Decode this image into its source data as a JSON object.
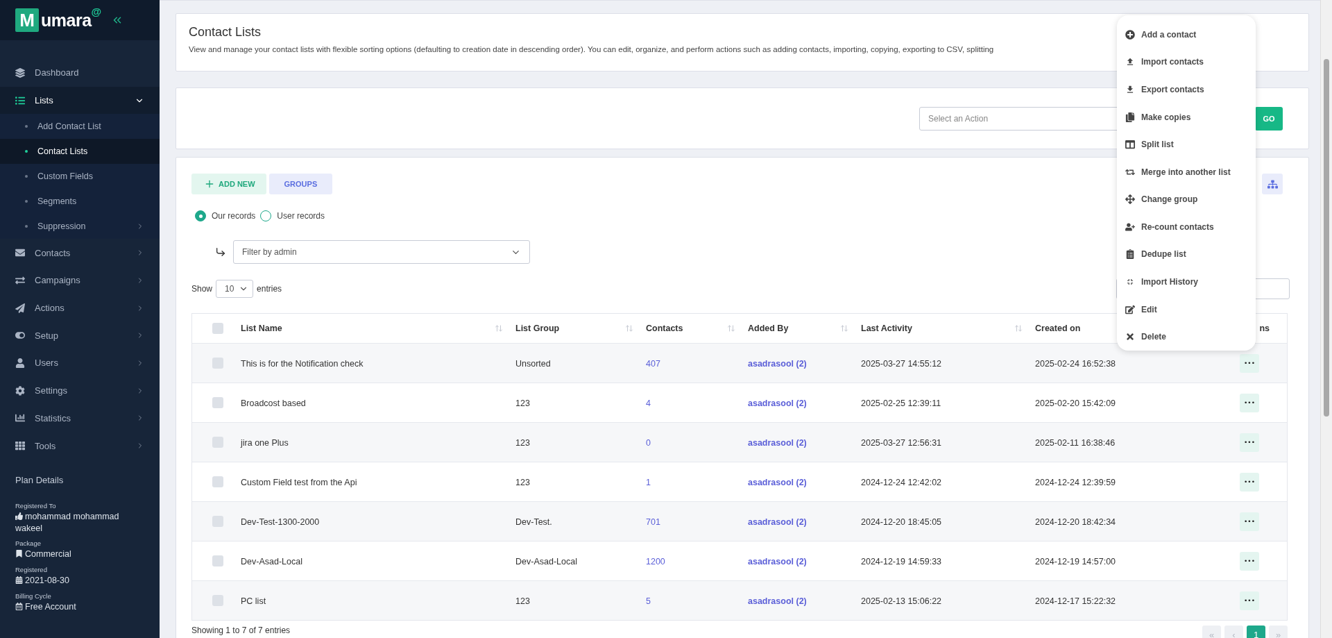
{
  "sidebar": {
    "logo": {
      "letter": "M",
      "text": "umara",
      "mark": "@"
    },
    "nav": [
      {
        "label": "Dashboard",
        "kind": "link",
        "selected": false
      },
      {
        "label": "Lists",
        "kind": "menu",
        "selected": true,
        "expanded": true,
        "children": [
          {
            "label": "Add Contact List",
            "kind": "link",
            "selected": false
          },
          {
            "label": "Contact Lists",
            "kind": "link",
            "selected": true
          },
          {
            "label": "Custom Fields",
            "kind": "link",
            "selected": false
          },
          {
            "label": "Segments",
            "kind": "link",
            "selected": false
          },
          {
            "label": "Suppression",
            "kind": "menu",
            "selected": false,
            "expanded": false
          }
        ]
      },
      {
        "label": "Contacts",
        "kind": "menu",
        "selected": false,
        "expanded": false
      },
      {
        "label": "Campaigns",
        "kind": "menu",
        "selected": false,
        "expanded": false
      },
      {
        "label": "Actions",
        "kind": "menu",
        "selected": false,
        "expanded": false
      },
      {
        "label": "Setup",
        "kind": "menu",
        "selected": false,
        "expanded": false
      },
      {
        "label": "Users",
        "kind": "menu",
        "selected": false,
        "expanded": false
      },
      {
        "label": "Settings",
        "kind": "menu",
        "selected": false,
        "expanded": false
      },
      {
        "label": "Statistics",
        "kind": "menu",
        "selected": false,
        "expanded": false
      },
      {
        "label": "Tools",
        "kind": "menu",
        "selected": false,
        "expanded": false
      }
    ],
    "plan": {
      "title": "Plan Details",
      "fields": [
        {
          "label": "Registered To",
          "value": "mohammad mohammad wakeel"
        },
        {
          "label": "Package",
          "value": "Commercial"
        },
        {
          "label": "Registered",
          "value": "2021-08-30"
        },
        {
          "label": "Billing Cycle",
          "value": "Free Account"
        }
      ]
    }
  },
  "header": {
    "title": "Contact Lists",
    "description": "View and manage your contact lists with flexible sorting options (defaulting to creation date in descending order). You can edit, organize, and perform actions such as adding contacts, importing, copying, exporting to CSV, splitting"
  },
  "bulk_action": {
    "placeholder": "Select an Action",
    "button": "GO"
  },
  "toolbar": {
    "add_button": "ADD NEW",
    "groups_button": "GROUPS"
  },
  "record_filter": [
    {
      "label": "Our records",
      "selected": true
    },
    {
      "label": "User records",
      "selected": false
    }
  ],
  "admin_filter": {
    "value": "Filter by admin"
  },
  "length": {
    "before": "Show",
    "value": "10",
    "after": "entries"
  },
  "table": {
    "select_all": {
      "checked": false
    },
    "columns": [
      {
        "label": "List Name",
        "sortable": true
      },
      {
        "label": "List Group",
        "sortable": true
      },
      {
        "label": "Contacts",
        "sortable": true
      },
      {
        "label": "Added By",
        "sortable": true
      },
      {
        "label": "Last Activity",
        "sortable": true
      },
      {
        "label": "Created on"
      },
      {
        "label": "ns"
      }
    ],
    "rows": [
      {
        "checked": false,
        "name": "This is for the Notification check",
        "group": "Unsorted",
        "contacts": "407",
        "added_by": "asadrasool (2)",
        "last_activity": "2025-03-27 14:55:12",
        "created_on": "2025-02-24 16:52:38",
        "action": "•••"
      },
      {
        "checked": false,
        "name": "Broadcost based",
        "group": "123",
        "contacts": "4",
        "added_by": "asadrasool (2)",
        "last_activity": "2025-02-25 12:39:11",
        "created_on": "2025-02-20 15:42:09",
        "action": "•••"
      },
      {
        "checked": false,
        "name": "jira one Plus",
        "group": "123",
        "contacts": "0",
        "added_by": "asadrasool (2)",
        "last_activity": "2025-03-27 12:56:31",
        "created_on": "2025-02-11 16:38:46",
        "action": "•••"
      },
      {
        "checked": false,
        "name": "Custom Field test from the Api",
        "group": "123",
        "contacts": "1",
        "added_by": "asadrasool (2)",
        "last_activity": "2024-12-24 12:42:02",
        "created_on": "2024-12-24 12:39:59",
        "action": "•••"
      },
      {
        "checked": false,
        "name": "Dev-Test-1300-2000",
        "group": "Dev-Test.",
        "contacts": "701",
        "added_by": "asadrasool (2)",
        "last_activity": "2024-12-20 18:45:05",
        "created_on": "2024-12-20 18:42:34",
        "action": "•••"
      },
      {
        "checked": false,
        "name": "Dev-Asad-Local",
        "group": "Dev-Asad-Local",
        "contacts": "1200",
        "added_by": "asadrasool (2)",
        "last_activity": "2024-12-19 14:59:33",
        "created_on": "2024-12-19 14:57:00",
        "action": "•••"
      },
      {
        "checked": false,
        "name": "PC list",
        "group": "123",
        "contacts": "5",
        "added_by": "asadrasool (2)",
        "last_activity": "2025-02-13 15:06:22",
        "created_on": "2024-12-17 15:22:32",
        "action": "•••"
      }
    ],
    "info": "Showing 1 to 7 of 7 entries",
    "pagination": [
      {
        "label": "«",
        "selected": false,
        "disabled": true
      },
      {
        "label": "‹",
        "selected": false,
        "disabled": true
      },
      {
        "label": "1",
        "selected": true,
        "disabled": false
      },
      {
        "label": "»",
        "selected": false,
        "disabled": true
      }
    ]
  },
  "row_menu": [
    {
      "label": "Add a contact"
    },
    {
      "label": "Import contacts"
    },
    {
      "label": "Export contacts"
    },
    {
      "label": "Make copies"
    },
    {
      "label": "Split list"
    },
    {
      "label": "Merge into another list"
    },
    {
      "label": "Change group"
    },
    {
      "label": "Re-count contacts"
    },
    {
      "label": "Dedupe list"
    },
    {
      "label": "Import History"
    },
    {
      "label": "Edit"
    },
    {
      "label": "Delete"
    }
  ]
}
